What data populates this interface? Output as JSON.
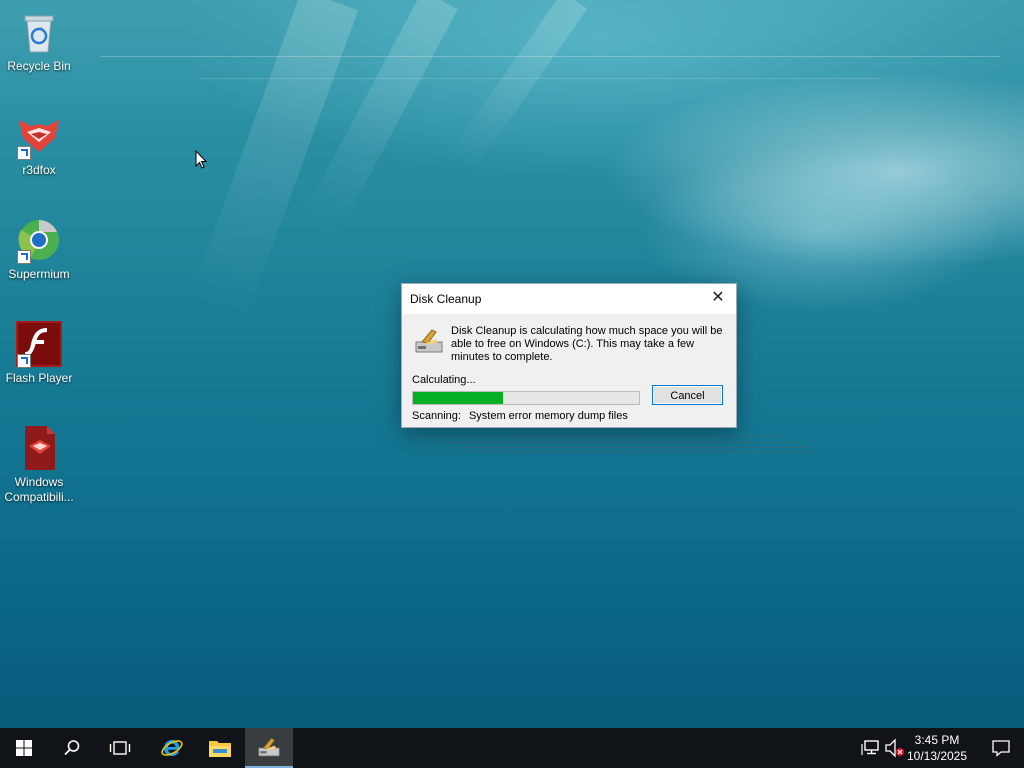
{
  "desktop": {
    "icons": [
      {
        "label": "Recycle Bin"
      },
      {
        "label": "r3dfox"
      },
      {
        "label": "Supermium"
      },
      {
        "label": "Flash Player"
      },
      {
        "label": "Windows Compatibili..."
      }
    ]
  },
  "dialog": {
    "title": "Disk Cleanup",
    "close_label": "✕",
    "message": "Disk Cleanup is calculating how much space you will be able to free on Windows (C:). This may take a few minutes to complete.",
    "status_label": "Calculating...",
    "progress_fraction": 0.4,
    "cancel_label": "Cancel",
    "scan_label": "Scanning:",
    "scan_item": "System error memory dump files"
  },
  "taskbar": {
    "time": "3:45 PM",
    "date": "10/13/2025",
    "accent": "#7fb0e0"
  },
  "colors": {
    "progress_green": "#06b025",
    "button_border": "#0078d7"
  }
}
